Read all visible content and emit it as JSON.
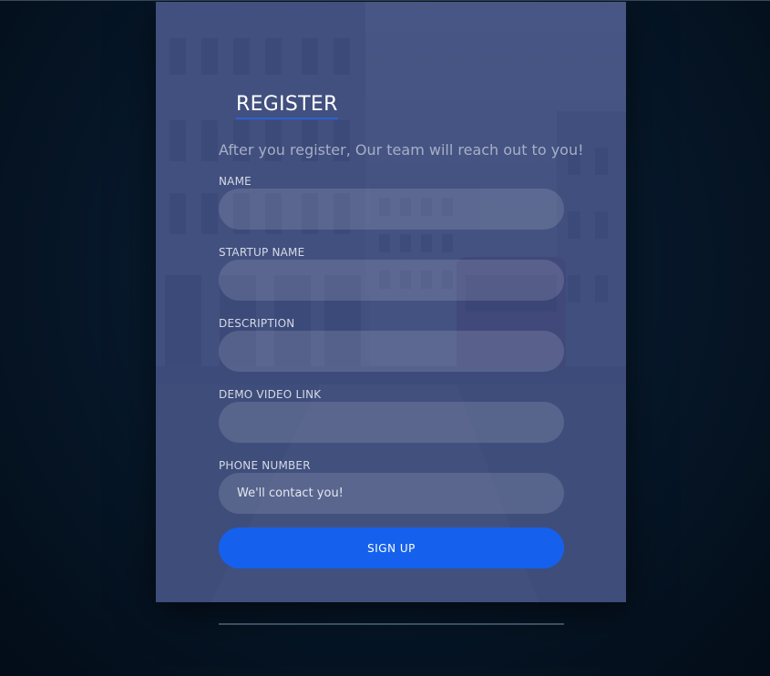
{
  "form": {
    "title": "REGISTER",
    "subtitle": "After you register, Our team will reach out to you!",
    "fields": [
      {
        "label": "NAME",
        "value": "",
        "placeholder": ""
      },
      {
        "label": "STARTUP NAME",
        "value": "",
        "placeholder": ""
      },
      {
        "label": "DESCRIPTION",
        "value": "",
        "placeholder": ""
      },
      {
        "label": "DEMO VIDEO LINK",
        "value": "",
        "placeholder": ""
      },
      {
        "label": "PHONE NUMBER",
        "value": "",
        "placeholder": "We'll contact you!"
      }
    ],
    "submit_label": "SIGN UP"
  },
  "colors": {
    "accent": "#1561ee",
    "card_tint": "#38487d",
    "page_background": "#07192c"
  }
}
